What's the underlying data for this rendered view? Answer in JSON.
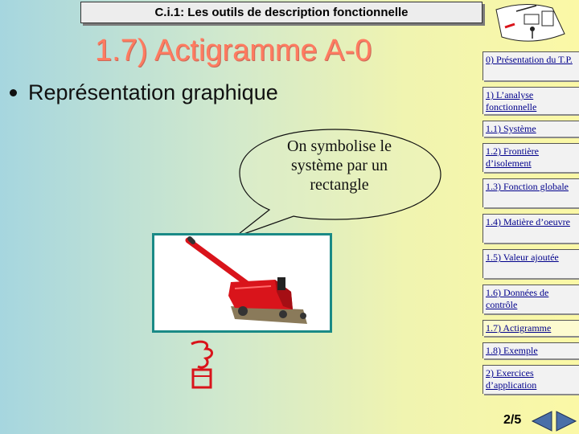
{
  "header": {
    "title": "C.i.1: Les outils de description fonctionnelle"
  },
  "slide": {
    "title": "1.7) Actigramme A-0",
    "bullet": "Représentation graphique",
    "bubble_lines": [
      "On symbolise le",
      "système par un",
      "rectangle"
    ]
  },
  "menu": {
    "items": [
      {
        "label": "0) Présentation du T.P."
      },
      {
        "label": "1) L’analyse fonctionnelle"
      },
      {
        "label": "1.1) Système"
      },
      {
        "label": "1.2) Frontière d’isolement"
      },
      {
        "label": "1.3) Fonction globale"
      },
      {
        "label": "1.4) Matière d’oeuvre"
      },
      {
        "label": "1.5) Valeur ajoutée"
      },
      {
        "label": "1.6) Données de contrôle"
      },
      {
        "label": "1.7) Actigramme"
      },
      {
        "label": "1.8) Exemple"
      },
      {
        "label": "2) Exercices d’application"
      }
    ],
    "active_index": 8
  },
  "footer": {
    "page": "2/5"
  },
  "colors": {
    "title": "#ff7b60",
    "frame": "#1a8a86",
    "link": "#00008b",
    "jack": "#d9141b"
  }
}
